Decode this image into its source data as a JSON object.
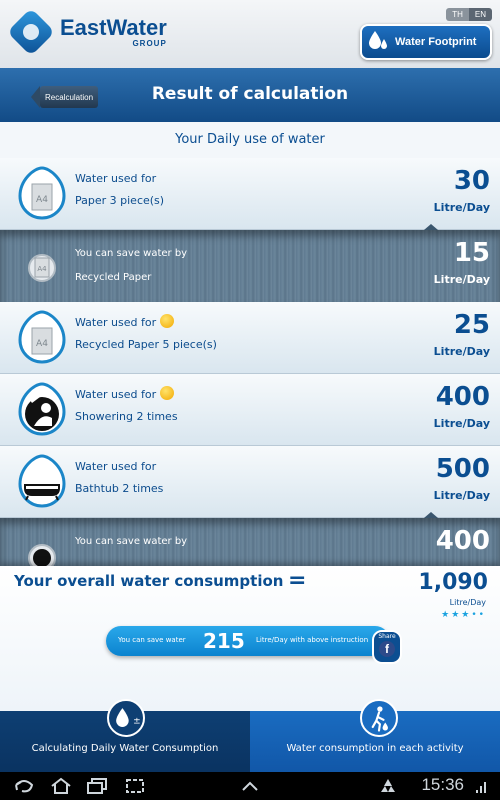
{
  "header": {
    "brand_name": "EastWater",
    "brand_sub": "GROUP",
    "lang_options": [
      "TH",
      "EN"
    ],
    "footprint_button": "Water Footprint"
  },
  "titlebar": {
    "back_label": "Recalculation",
    "title": "Result of calculation"
  },
  "subtitle": "Your Daily use of water",
  "rows": [
    {
      "style": "white",
      "icon": "paper-a4-icon",
      "line1": "Water used for",
      "line2": "Paper 3 piece(s)",
      "value": "30",
      "unit": "Litre/Day",
      "smiley": false
    },
    {
      "style": "dark",
      "icon": "paper-a4-icon",
      "line1": "You can save water by",
      "line2": "Recycled Paper",
      "value": "15",
      "unit": "Litre/Day",
      "smiley": false
    },
    {
      "style": "white",
      "icon": "paper-a4-icon",
      "line1": "Water used for",
      "line2": "Recycled Paper 5 piece(s)",
      "value": "25",
      "unit": "Litre/Day",
      "smiley": true
    },
    {
      "style": "white",
      "icon": "shower-icon",
      "line1": "Water used for",
      "line2": "Showering 2 times",
      "value": "400",
      "unit": "Litre/Day",
      "smiley": true
    },
    {
      "style": "white",
      "icon": "bathtub-icon",
      "line1": "Water used for",
      "line2": "Bathtub 2 times",
      "value": "500",
      "unit": "Litre/Day",
      "smiley": false
    },
    {
      "style": "dark",
      "icon": "shower-icon",
      "line1": "You can save water by",
      "line2": "",
      "value": "400",
      "unit": "",
      "smiley": false
    }
  ],
  "summary": {
    "label": "Your overall water consumption",
    "equals": "=",
    "value": "1,090",
    "unit": "Litre/Day",
    "rating_stars": "★★★••",
    "save_prefix": "You can save water",
    "save_value": "215",
    "save_suffix": "Litre/Day with above instruction",
    "share_label": "Share",
    "share_fb": "f"
  },
  "tabs": [
    {
      "label": "Calculating Daily Water Consumption",
      "icon": "water-drop-plus-minus-icon",
      "active": true
    },
    {
      "label": "Water consumption in each activity",
      "icon": "walking-person-icon",
      "active": false
    }
  ],
  "system": {
    "time": "15:36"
  },
  "colors": {
    "brand_blue": "#0b4e91",
    "accent_blue": "#1aa2e0",
    "smiley_yellow": "#f2a800"
  }
}
